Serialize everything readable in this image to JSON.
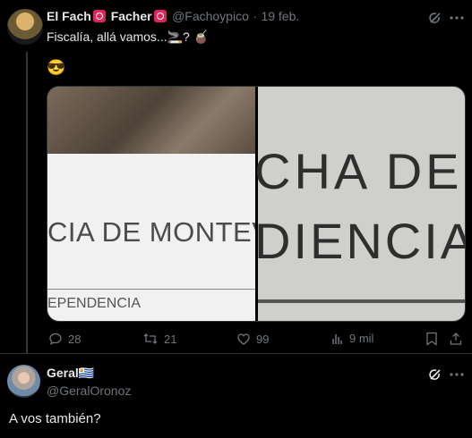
{
  "tweet1": {
    "name_a": "El Fach",
    "name_b": "Facher",
    "handle": "@Fachoypico",
    "dot": "·",
    "date": "19 feb.",
    "text": "Fiscalía, allá vamos...",
    "text_emojis": "🚬? 🧉",
    "emoji_line": "😎",
    "image_left_text_main": "CIA DE MONTEVI",
    "image_left_text_sub": "EPENDENCIA",
    "image_right_text_top": "CHA DE",
    "image_right_text_bottom": "DIENCIA",
    "actions": {
      "replies": "28",
      "reposts": "21",
      "likes": "99",
      "views": "9 mil"
    }
  },
  "tweet2": {
    "name": "Geral",
    "flag": "🇺🇾",
    "handle": "@GeralOronoz",
    "text": "A vos también?"
  }
}
